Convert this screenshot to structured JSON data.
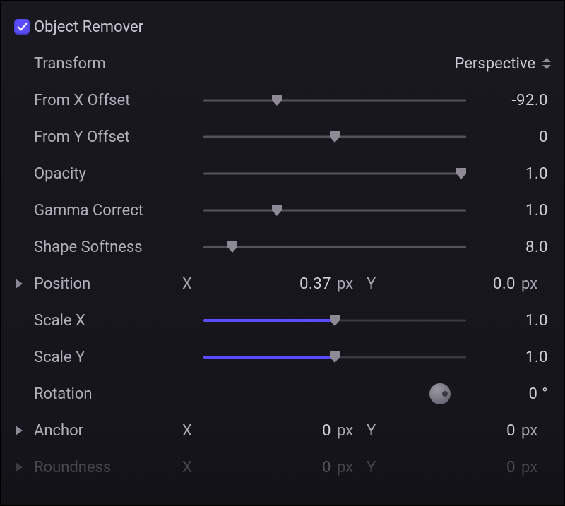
{
  "title": "Object Remover",
  "transform": {
    "label": "Transform",
    "value": "Perspective"
  },
  "params": {
    "from_x_offset": {
      "label": "From X Offset",
      "value": "-92.0",
      "pos": 0.28
    },
    "from_y_offset": {
      "label": "From Y Offset",
      "value": "0",
      "pos": 0.5
    },
    "opacity": {
      "label": "Opacity",
      "value": "1.0",
      "pos": 0.98
    },
    "gamma_correct": {
      "label": "Gamma Correct",
      "value": "1.0",
      "pos": 0.28
    },
    "shape_softness": {
      "label": "Shape Softness",
      "value": "8.0",
      "pos": 0.11
    },
    "scale_x": {
      "label": "Scale X",
      "value": "1.0",
      "pos": 0.5,
      "accent": true
    },
    "scale_y": {
      "label": "Scale Y",
      "value": "1.0",
      "pos": 0.5,
      "accent": true
    }
  },
  "rotation": {
    "label": "Rotation",
    "value": "0",
    "unit": "°",
    "pos": 0.9
  },
  "position": {
    "label": "Position",
    "x": "0.37",
    "y": "0.0",
    "unit": "px"
  },
  "anchor": {
    "label": "Anchor",
    "x": "0",
    "y": "0",
    "unit": "px"
  },
  "roundness": {
    "label": "Roundness",
    "x": "0",
    "y": "0",
    "unit": "px"
  }
}
